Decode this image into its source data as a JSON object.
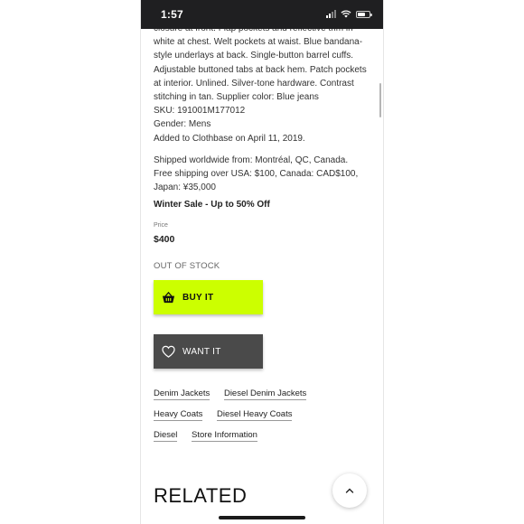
{
  "status_bar": {
    "time": "1:57"
  },
  "description": {
    "lines": [
      "closure at front. Flap pockets and reflective trim in",
      "white at chest. Welt pockets at waist. Blue bandana-",
      "style underlays at back. Single-button barrel cuffs.",
      "Adjustable buttoned tabs at back hem. Patch pockets",
      "at interior. Unlined. Silver-tone hardware. Contrast",
      "stitching in tan. Supplier color: Blue jeans",
      "SKU: 191001M177012",
      "Gender: Mens",
      "Added to Clothbase on April 11, 2019."
    ]
  },
  "shipping": {
    "lines": [
      "Shipped worldwide from: Montréal, QC, Canada.",
      "Free shipping over USA: $100, Canada: CAD$100,",
      "Japan: ¥35,000"
    ]
  },
  "sale_text": "Winter Sale - Up to 50% Off",
  "price": {
    "label": "Price",
    "value": "$400"
  },
  "stock_status": "OUT OF STOCK",
  "buttons": {
    "buy": {
      "label": "BUY IT",
      "icon": "basket-icon",
      "color": "#ccff00"
    },
    "want": {
      "label": "WANT IT",
      "icon": "heart-icon",
      "color": "#4a4a4a"
    }
  },
  "tags": [
    [
      "Denim Jackets",
      "Diesel Denim Jackets"
    ],
    [
      "Heavy Coats",
      "Diesel Heavy Coats"
    ],
    [
      "Diesel",
      "Store Information"
    ]
  ],
  "related_heading": "RELATED",
  "scroll_top_icon": "chevron-up-icon"
}
